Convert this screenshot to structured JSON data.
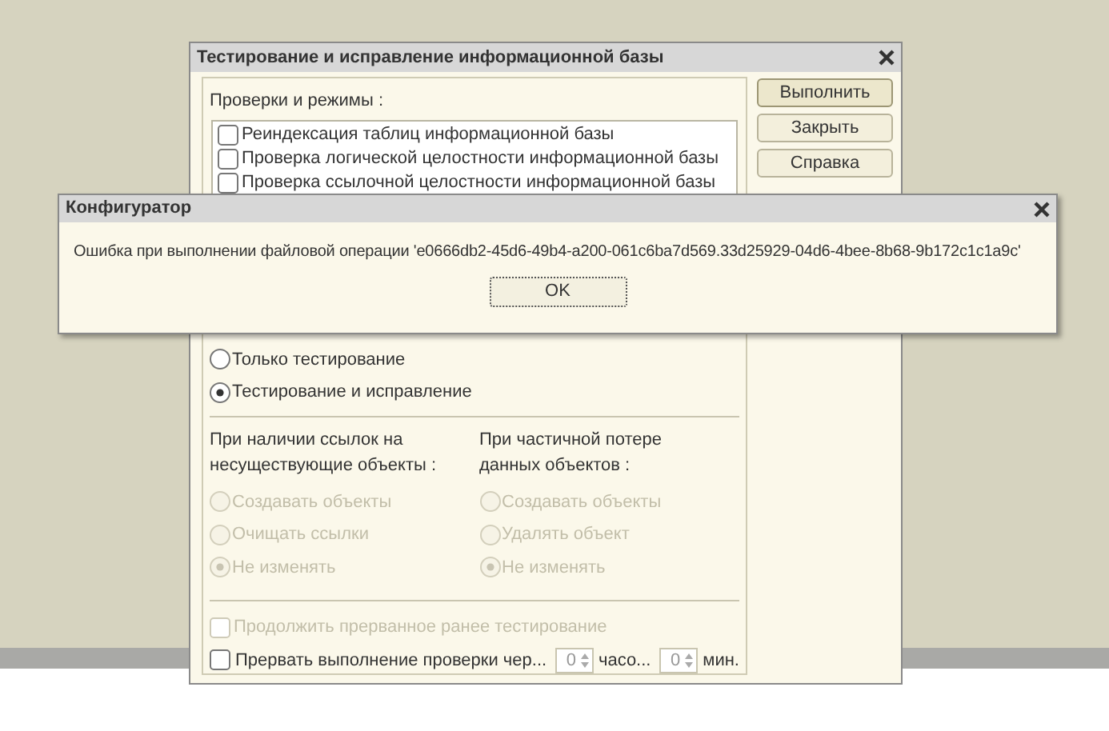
{
  "main_window": {
    "title": "Тестирование и исправление информационной базы",
    "checks_label": "Проверки и режимы :",
    "checks": [
      {
        "label": "Реиндексация таблиц информационной базы",
        "checked": false
      },
      {
        "label": "Проверка логической целостности информационной базы",
        "checked": false
      },
      {
        "label": "Проверка ссылочной целостности информационной базы",
        "checked": false
      }
    ],
    "modes": [
      {
        "label": "Только тестирование",
        "selected": false
      },
      {
        "label": "Тестирование и исправление",
        "selected": true
      }
    ],
    "option_groups": [
      {
        "heading": "При наличии ссылок на несуществующие объекты :",
        "options": [
          {
            "label": "Создавать объекты",
            "selected": false,
            "disabled": true
          },
          {
            "label": "Очищать ссылки",
            "selected": false,
            "disabled": true
          },
          {
            "label": "Не изменять",
            "selected": true,
            "disabled": true
          }
        ]
      },
      {
        "heading": "При частичной потере данных объектов :",
        "options": [
          {
            "label": "Создавать объекты",
            "selected": false,
            "disabled": true
          },
          {
            "label": "Удалять объект",
            "selected": false,
            "disabled": true
          },
          {
            "label": "Не изменять",
            "selected": true,
            "disabled": true
          }
        ]
      }
    ],
    "continue_check": {
      "label": "Продолжить прерванное ранее тестирование",
      "checked": false,
      "disabled": true
    },
    "interrupt_check": {
      "label": "Прервать выполнение проверки чер...",
      "checked": false,
      "disabled": false
    },
    "hours": {
      "value": "0",
      "unit": "часо..."
    },
    "minutes": {
      "value": "0",
      "unit": "мин."
    },
    "buttons": [
      {
        "label": "Выполнить",
        "default": true
      },
      {
        "label": "Закрыть",
        "default": false
      },
      {
        "label": "Справка",
        "default": false
      }
    ]
  },
  "error_dialog": {
    "title": "Конфигуратор",
    "message": "Ошибка при выполнении файловой операции  'e0666db2-45d6-49b4-a200-061c6ba7d569.33d25929-04d6-4bee-8b68-9b172c1c1a9c'",
    "button": "OK"
  }
}
